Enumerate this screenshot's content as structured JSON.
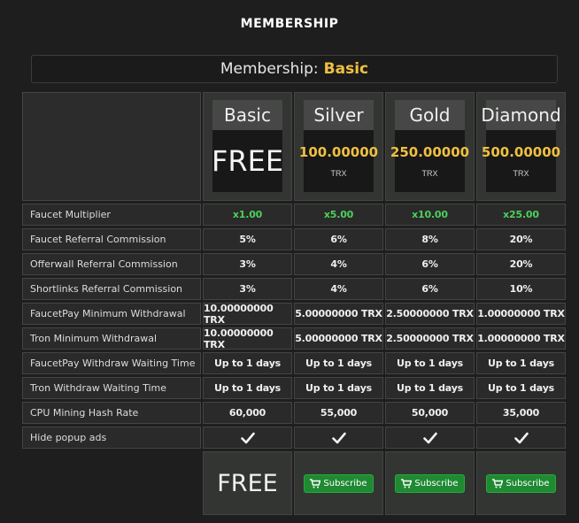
{
  "page": {
    "title": "MEMBERSHIP"
  },
  "current": {
    "label": "Membership:",
    "level": "Basic"
  },
  "tiers": [
    {
      "name": "Basic",
      "price": "FREE",
      "currency": ""
    },
    {
      "name": "Silver",
      "price": "100.00000",
      "currency": "TRX"
    },
    {
      "name": "Gold",
      "price": "250.00000",
      "currency": "TRX"
    },
    {
      "name": "Diamond",
      "price": "500.00000",
      "currency": "TRX"
    }
  ],
  "rows": [
    {
      "label": "Faucet Multiplier",
      "values": [
        "x1.00",
        "x5.00",
        "x10.00",
        "x25.00"
      ]
    },
    {
      "label": "Faucet Referral Commission",
      "values": [
        "5%",
        "6%",
        "8%",
        "20%"
      ]
    },
    {
      "label": "Offerwall Referral Commission",
      "values": [
        "3%",
        "4%",
        "6%",
        "20%"
      ]
    },
    {
      "label": "Shortlinks Referral Commission",
      "values": [
        "3%",
        "4%",
        "6%",
        "10%"
      ]
    },
    {
      "label": "FaucetPay Minimum Withdrawal",
      "values": [
        "10.00000000 TRX",
        "5.00000000 TRX",
        "2.50000000 TRX",
        "1.00000000 TRX"
      ]
    },
    {
      "label": "Tron Minimum Withdrawal",
      "values": [
        "10.00000000 TRX",
        "5.00000000 TRX",
        "2.50000000 TRX",
        "1.00000000 TRX"
      ]
    },
    {
      "label": "FaucetPay Withdraw Waiting Time",
      "values": [
        "Up to 1 days",
        "Up to 1 days",
        "Up to 1 days",
        "Up to 1 days"
      ]
    },
    {
      "label": "Tron Withdraw Waiting Time",
      "values": [
        "Up to 1 days",
        "Up to 1 days",
        "Up to 1 days",
        "Up to 1 days"
      ]
    },
    {
      "label": "CPU Mining Hash Rate",
      "values": [
        "60,000",
        "55,000",
        "50,000",
        "35,000"
      ]
    },
    {
      "label": "Hide popup ads",
      "values": [
        "",
        "",
        "",
        ""
      ]
    }
  ],
  "footer": {
    "free_label": "FREE",
    "subscribe_label": "Subscribe"
  },
  "colors": {
    "accent_gold": "#f0c040",
    "multiplier_green": "#4cd05a",
    "subscribe_green": "#1f8a32"
  },
  "icons": {
    "check": "check-icon",
    "cart": "cart-icon"
  }
}
